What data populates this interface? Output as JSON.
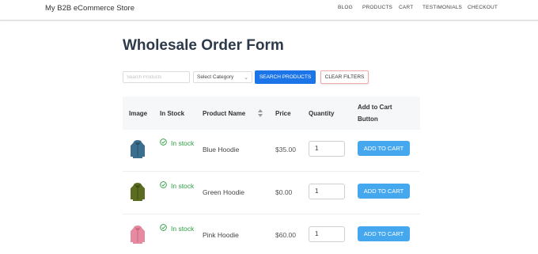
{
  "header": {
    "store_name": "My B2B eCommerce Store",
    "nav": [
      {
        "label": "BLOG"
      },
      {
        "label": "PRODUCTS"
      },
      {
        "label": "CART"
      },
      {
        "label": "TESTIMONIALS"
      },
      {
        "label": "CHECKOUT"
      }
    ]
  },
  "page": {
    "title": "Wholesale Order Form"
  },
  "filters": {
    "search_placeholder": "Search Products",
    "category_value": "Select Category",
    "search_button": "SEARCH PRODUCTS",
    "clear_button": "CLEAR FILTERS"
  },
  "table": {
    "headers": {
      "image": "Image",
      "in_stock": "In Stock",
      "product_name": "Product Name",
      "price": "Price",
      "quantity": "Quantity",
      "add_to_cart_line1": "Add to Cart",
      "add_to_cart_line2": "Button"
    },
    "rows": [
      {
        "stock": "In stock",
        "name": "Blue Hoodie",
        "price": "$35.00",
        "qty": "1",
        "button": "ADD TO CART",
        "hoodie_color": "#3a6f8f"
      },
      {
        "stock": "In stock",
        "name": "Green Hoodie",
        "price": "$0.00",
        "qty": "1",
        "button": "ADD TO CART",
        "hoodie_color": "#5b6b1f"
      },
      {
        "stock": "In stock",
        "name": "Pink Hoodie",
        "price": "$60.00",
        "qty": "1",
        "button": "ADD TO CART",
        "hoodie_color": "#e58aa0"
      }
    ]
  },
  "colors": {
    "primary_button": "#1b75e8",
    "add_button": "#45a8ef",
    "stock_green": "#2f9e44",
    "title": "#2d3a4a"
  }
}
